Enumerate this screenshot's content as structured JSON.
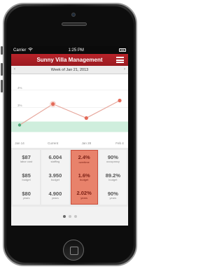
{
  "statusbar": {
    "carrier": "Carrier",
    "time": "1:25 PM"
  },
  "navbar": {
    "title": "Sunny Villa Management"
  },
  "subbar": {
    "week_label": "Week of Jan 21, 2013"
  },
  "chart_data": {
    "type": "line",
    "categories": [
      "Jan 14",
      "Current",
      "Jan 28",
      "Feb 4"
    ],
    "y_ticks": [
      "4%",
      "3%"
    ],
    "ylim": [
      1.5,
      4.5
    ],
    "series": [
      {
        "values": [
          2.0,
          3.2,
          2.4,
          3.4
        ]
      }
    ],
    "band": [
      1.6,
      2.2
    ],
    "grid": true
  },
  "stats": [
    {
      "cells": [
        {
          "value": "$87",
          "label": "labor cost"
        },
        {
          "value": "$85",
          "label": "budget"
        },
        {
          "value": "$80",
          "label": "years"
        }
      ]
    },
    {
      "cells": [
        {
          "value": "6.004",
          "label": "staffing"
        },
        {
          "value": "3.950",
          "label": "budget"
        },
        {
          "value": "4.900",
          "label": "years"
        }
      ]
    },
    {
      "cells": [
        {
          "value": "2.4%",
          "label": "overtime"
        },
        {
          "value": "1.6%",
          "label": "budget"
        },
        {
          "value": "2.02%",
          "label": "years"
        }
      ]
    },
    {
      "cells": [
        {
          "value": "90%",
          "label": "occupancy"
        },
        {
          "value": "89.2%",
          "label": "budget"
        },
        {
          "value": "90%",
          "label": "years"
        }
      ]
    }
  ],
  "colors": {
    "nav": "#b8232a",
    "highlight": "#e8826b",
    "line": "#e46b5a",
    "band": "#cfeedd"
  }
}
